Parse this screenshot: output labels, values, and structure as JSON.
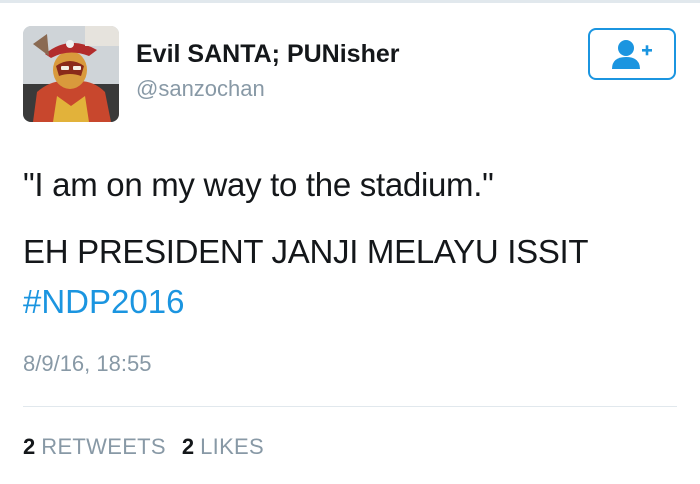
{
  "tweet": {
    "author": {
      "display_name": "Evil SANTA; PUNisher",
      "username": "@sanzochan"
    },
    "text_lines": [
      "\"I am on my way to the stadium.\"",
      "EH PRESIDENT JANJI MELAYU ISSIT"
    ],
    "hashtag": "#NDP2016",
    "timestamp": "8/9/16, 18:55",
    "stats": {
      "retweets_count": "2",
      "retweets_label": "RETWEETS",
      "likes_count": "2",
      "likes_label": "LIKES"
    }
  },
  "icons": {
    "follow_button": "add-user-icon"
  },
  "colors": {
    "accent": "#1b95e0",
    "text_primary": "#14171a",
    "text_secondary": "#8899a6",
    "divider": "#e1e8ed"
  }
}
